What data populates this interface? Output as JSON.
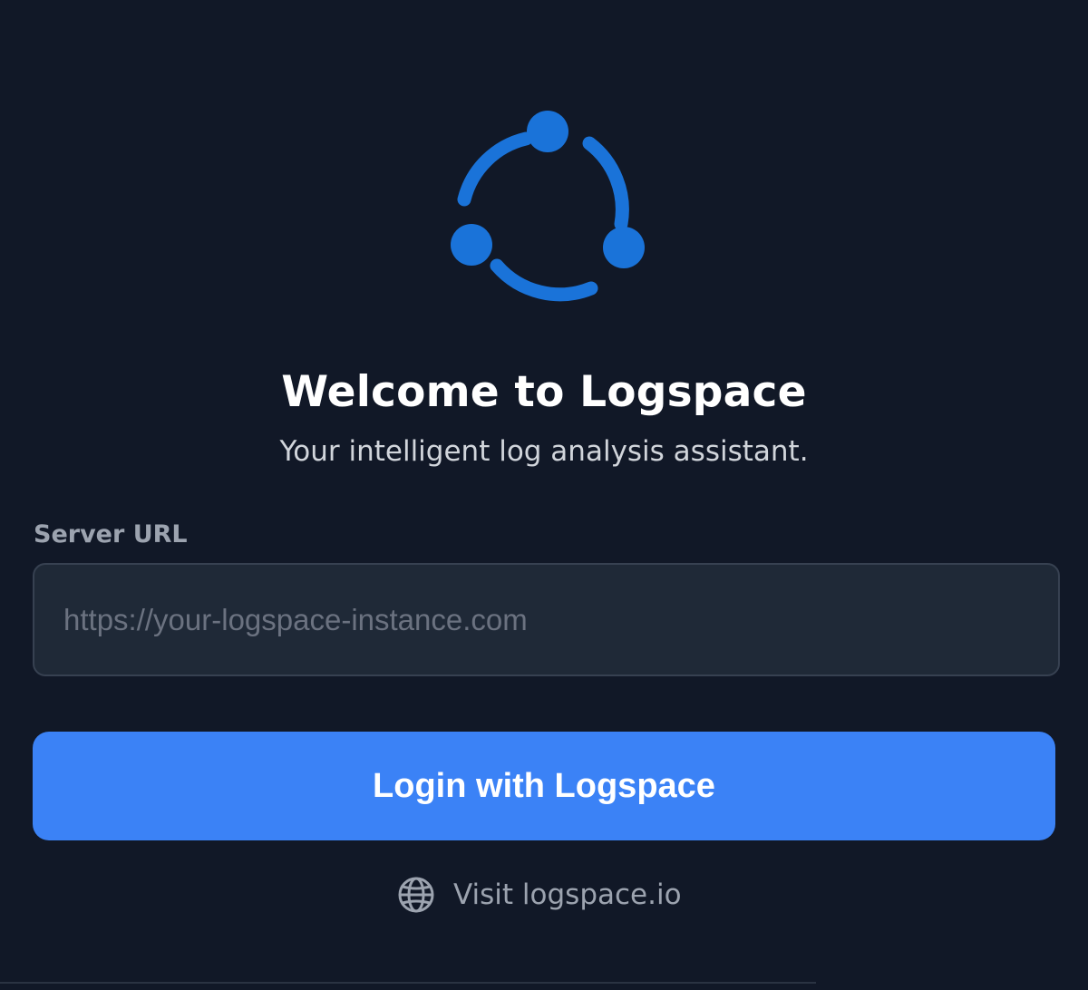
{
  "app": {
    "logo_icon": "logspace-logo-icon",
    "accent_color": "#1a73d9",
    "title": "Welcome to Logspace",
    "subtitle": "Your intelligent log analysis assistant."
  },
  "form": {
    "server_url_label": "Server URL",
    "server_url_value": "",
    "server_url_placeholder": "https://your-logspace-instance.com",
    "login_button_label": "Login with Logspace",
    "login_button_color": "#3b82f6"
  },
  "footer": {
    "visit_icon": "globe-icon",
    "visit_label": "Visit logspace.io"
  }
}
